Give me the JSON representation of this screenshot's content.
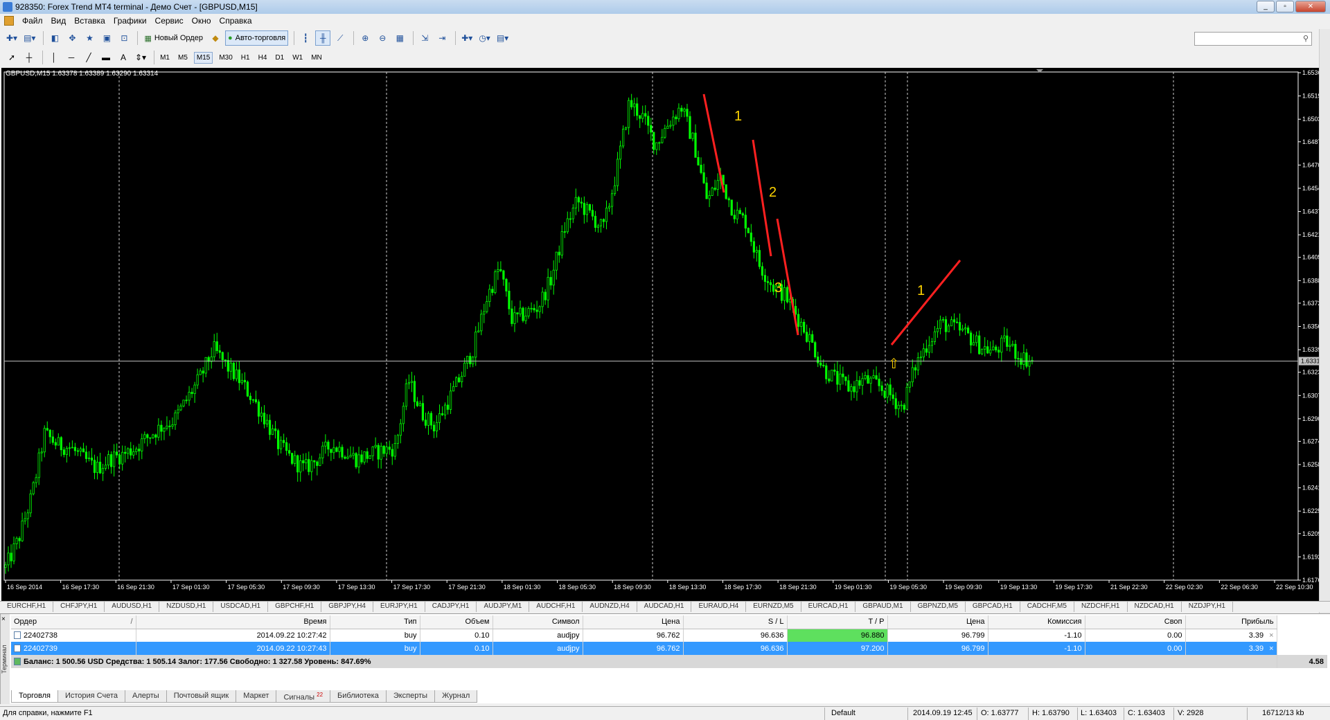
{
  "window": {
    "title": "928350: Forex Trend MT4 terminal - Демо Счет - [GBPUSD,M15]"
  },
  "menu": [
    "Файл",
    "Вид",
    "Вставка",
    "Графики",
    "Сервис",
    "Окно",
    "Справка"
  ],
  "toolbar": {
    "new_order": "Новый Ордер",
    "auto_trading": "Авто-торговля",
    "timeframes": [
      "M1",
      "M5",
      "M15",
      "M30",
      "H1",
      "H4",
      "D1",
      "W1",
      "MN"
    ],
    "selected_timeframe": "M15"
  },
  "chart_info": "GBPUSD,M15  1.63378 1.63389 1.63290 1.63314",
  "chart_data": {
    "type": "candlestick",
    "symbol": "GBPUSD",
    "timeframe": "M15",
    "ylim": [
      1.6176,
      1.65365
    ],
    "y_ticks": [
      "1.65360",
      "1.65195",
      "1.65030",
      "1.64870",
      "1.64705",
      "1.64540",
      "1.64375",
      "1.64210",
      "1.64050",
      "1.63885",
      "1.63725",
      "1.63560",
      "1.63395",
      "1.63235",
      "1.63070",
      "1.62905",
      "1.62745",
      "1.62580",
      "1.62415",
      "1.62250",
      "1.62090",
      "1.61925",
      "1.61760"
    ],
    "current_price": "1.63314",
    "x_ticks": [
      "16 Sep 2014",
      "16 Sep 17:30",
      "16 Sep 21:30",
      "17 Sep 01:30",
      "17 Sep 05:30",
      "17 Sep 09:30",
      "17 Sep 13:30",
      "17 Sep 17:30",
      "17 Sep 21:30",
      "18 Sep 01:30",
      "18 Sep 05:30",
      "18 Sep 09:30",
      "18 Sep 13:30",
      "18 Sep 17:30",
      "18 Sep 21:30",
      "19 Sep 01:30",
      "19 Sep 05:30",
      "19 Sep 09:30",
      "19 Sep 13:30",
      "19 Sep 17:30",
      "21 Sep 22:30",
      "22 Sep 02:30",
      "22 Sep 06:30",
      "22 Sep 10:30"
    ],
    "price_path": [
      1.6185,
      1.6205,
      1.6235,
      1.628,
      1.6272,
      1.627,
      1.6262,
      1.6255,
      1.6262,
      1.6265,
      1.627,
      1.6278,
      1.6285,
      1.629,
      1.6305,
      1.632,
      1.634,
      1.6328,
      1.6318,
      1.6305,
      1.629,
      1.6272,
      1.6262,
      1.6255,
      1.6262,
      1.6272,
      1.6268,
      1.6262,
      1.6265,
      1.6268,
      1.627,
      1.6318,
      1.6295,
      1.6285,
      1.6302,
      1.632,
      1.634,
      1.6375,
      1.6398,
      1.636,
      1.6365,
      1.637,
      1.639,
      1.6425,
      1.6445,
      1.6435,
      1.6425,
      1.6465,
      1.6515,
      1.6505,
      1.6485,
      1.65,
      1.6512,
      1.6485,
      1.6445,
      1.6462,
      1.6438,
      1.643,
      1.64,
      1.6385,
      1.6378,
      1.6362,
      1.6345,
      1.6325,
      1.6318,
      1.6312,
      1.6318,
      1.6315,
      1.6308,
      1.6298,
      1.6328,
      1.6345,
      1.6358,
      1.6355,
      1.635,
      1.6342,
      1.6338,
      1.6345,
      1.6335,
      1.6331
    ],
    "annotations": [
      {
        "label": "1"
      },
      {
        "label": "2"
      },
      {
        "label": "3"
      },
      {
        "label": "1"
      }
    ]
  },
  "symbol_tabs": [
    "EURCHF,H1",
    "CHFJPY,H1",
    "AUDUSD,H1",
    "NZDUSD,H1",
    "USDCAD,H1",
    "GBPCHF,H1",
    "GBPJPY,H4",
    "EURJPY,H1",
    "CADJPY,H1",
    "AUDJPY,M1",
    "AUDCHF,H1",
    "AUDNZD,H4",
    "AUDCAD,H1",
    "EURAUD,H4",
    "EURNZD,M5",
    "EURCAD,H1",
    "GBPAUD,M1",
    "GBPNZD,M5",
    "GBPCAD,H1",
    "CADCHF,M5",
    "NZDCHF,H1",
    "NZDCAD,H1",
    "NZDJPY,H1"
  ],
  "orders": {
    "headers": [
      "Ордер",
      "/",
      "Время",
      "Тип",
      "Объем",
      "Символ",
      "Цена",
      "S / L",
      "T / P",
      "Цена",
      "Комиссия",
      "Своп",
      "Прибыль"
    ],
    "rows": [
      {
        "order": "22402738",
        "time": "2014.09.22 10:27:42",
        "type": "buy",
        "volume": "0.10",
        "symbol": "audjpy",
        "price": "96.762",
        "sl": "96.636",
        "tp": "96.880",
        "cur": "96.799",
        "comm": "-1.10",
        "swap": "0.00",
        "profit": "3.39"
      },
      {
        "order": "22402739",
        "time": "2014.09.22 10:27:43",
        "type": "buy",
        "volume": "0.10",
        "symbol": "audjpy",
        "price": "96.762",
        "sl": "96.636",
        "tp": "97.200",
        "cur": "96.799",
        "comm": "-1.10",
        "swap": "0.00",
        "profit": "3.39"
      }
    ],
    "balance_line": "Баланс: 1 500.56 USD  Средства: 1 505.14  Залог: 177.56  Свободно: 1 327.58  Уровень: 847.69%",
    "total_profit": "4.58"
  },
  "terminal_label": "Терминал",
  "terminal_tabs": [
    "Торговля",
    "История Счета",
    "Алерты",
    "Почтовый ящик",
    "Маркет",
    "Сигналы",
    "Библиотека",
    "Эксперты",
    "Журнал"
  ],
  "signals_badge": "22",
  "status": {
    "help": "Для справки, нажмите F1",
    "profile": "Default",
    "time": "2014.09.19 12:45",
    "open": "O: 1.63777",
    "high": "H: 1.63790",
    "low": "L: 1.63403",
    "close": "C: 1.63403",
    "vol": "V: 2928",
    "traffic": "16712/13 kb"
  }
}
